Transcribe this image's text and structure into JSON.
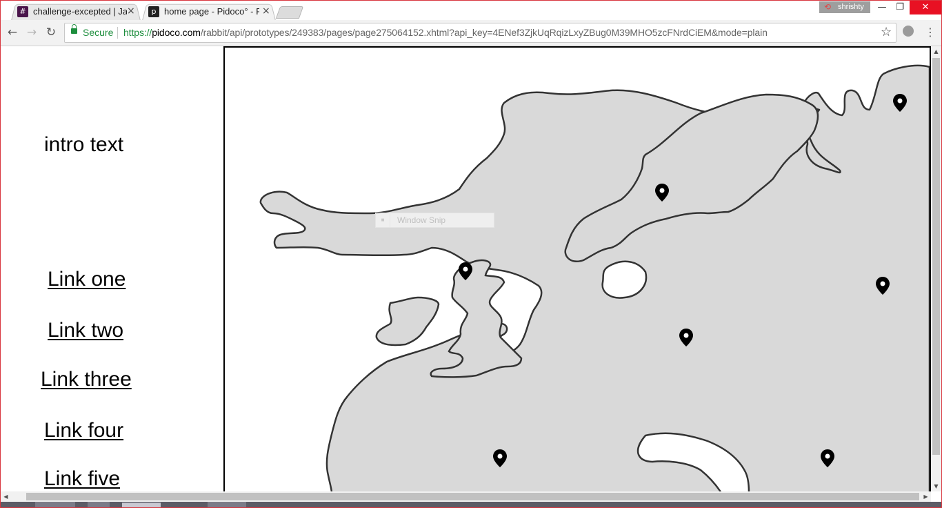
{
  "browser": {
    "tabs": [
      {
        "title": "challenge-excepted | Jaag",
        "favicon_color": "#4a154b",
        "favicon_glyph": "#",
        "active": false
      },
      {
        "title": "home page - Pidoco° - Pr",
        "favicon_color": "#222222",
        "favicon_glyph": "p",
        "active": true
      }
    ],
    "profile_name": "shrishty",
    "window_controls": {
      "minimize": "—",
      "restore": "❐",
      "close": "✕"
    },
    "nav": {
      "back": "←",
      "forward": "→",
      "reload": "↻",
      "menu": "⋮"
    },
    "security_label": "Secure",
    "url_scheme": "https://",
    "url_host": "pidoco.com",
    "url_path": "/rabbit/api/prototypes/249383/pages/page275064152.xhtml?api_key=4ENef3ZjkUqRqizLxyZBug0M39MHO5zcFNrdCiEM&mode=plain",
    "bookmark_icon": "☆",
    "tab_close_glyph": "×"
  },
  "page": {
    "intro_text": "intro text",
    "links": [
      "Link one",
      "Link two",
      "Link three",
      "Link four",
      "Link five"
    ],
    "map": {
      "land_color": "#d9d9d9",
      "outline_color": "#333333",
      "marker_color": "#000000",
      "marker_icon": "map-pin-icon",
      "marker_count": 8
    },
    "overlay_snip": "Window Snip"
  },
  "colors": {
    "accent_secure": "#1e8e3e",
    "window_border": "#d9363e",
    "close_button": "#e81123"
  }
}
